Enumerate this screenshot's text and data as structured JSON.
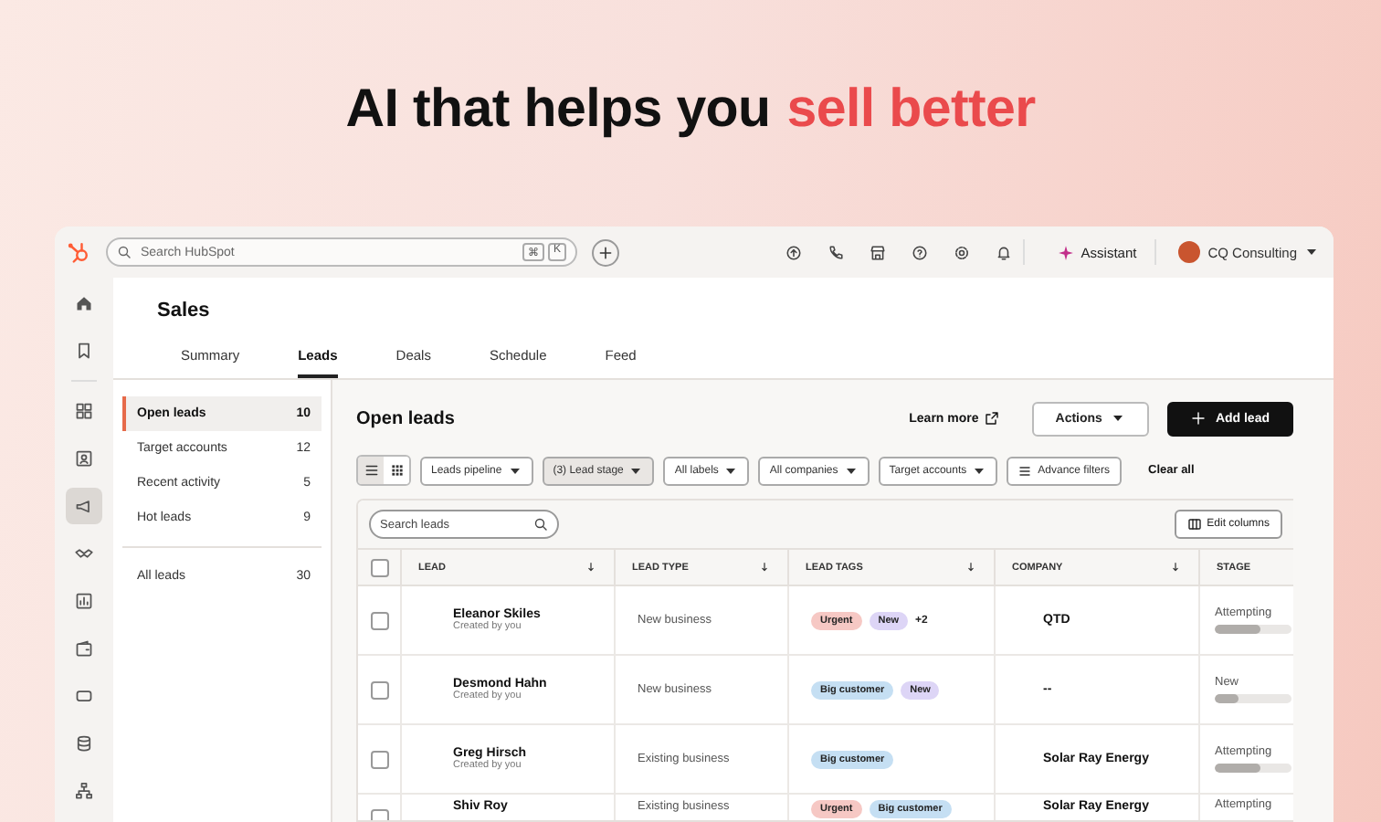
{
  "headline": {
    "text": "AI that helps you",
    "highlight": "sell better"
  },
  "topbar": {
    "search_placeholder": "Search HubSpot",
    "shortcut": [
      "⌘",
      "K"
    ],
    "icons": [
      {
        "kind": "upgrade"
      },
      {
        "kind": "phone"
      },
      {
        "kind": "store"
      },
      {
        "kind": "help"
      },
      {
        "kind": "settings"
      },
      {
        "kind": "bell"
      }
    ],
    "assistant": "Assistant",
    "account": "CQ Consulting"
  },
  "rail": [
    {
      "kind": "home",
      "selected": false
    },
    {
      "kind": "bookmark",
      "selected": false
    },
    {
      "kind": "grid",
      "selected": false
    },
    {
      "kind": "contact",
      "selected": false
    },
    {
      "kind": "megaphone",
      "selected": true
    },
    {
      "kind": "handshake",
      "selected": false
    },
    {
      "kind": "report",
      "selected": false
    },
    {
      "kind": "wallet",
      "selected": false
    },
    {
      "kind": "chat",
      "selected": false
    },
    {
      "kind": "database",
      "selected": false
    },
    {
      "kind": "tree",
      "selected": false
    }
  ],
  "page": {
    "title": "Sales",
    "tabs": [
      {
        "label": "Summary",
        "selected": false
      },
      {
        "label": "Leads",
        "selected": true
      },
      {
        "label": "Deals",
        "selected": false
      },
      {
        "label": "Schedule",
        "selected": false
      },
      {
        "label": "Feed",
        "selected": false
      }
    ]
  },
  "views": [
    {
      "label": "Open leads",
      "count": "10",
      "selected": true
    },
    {
      "label": "Target accounts",
      "count": "12",
      "selected": false
    },
    {
      "label": "Recent activity",
      "count": "5",
      "selected": false
    },
    {
      "label": "Hot leads",
      "count": "9",
      "selected": false
    }
  ],
  "all_views": [
    {
      "label": "All leads",
      "count": "30",
      "selected": false
    }
  ],
  "content": {
    "title": "Open leads",
    "learn_more": "Learn more",
    "actions": "Actions",
    "add_lead": "Add lead"
  },
  "view_toggle": [
    {
      "kind": "list",
      "selected": true
    },
    {
      "kind": "grid",
      "selected": false
    }
  ],
  "filters": [
    {
      "label": "Leads pipeline",
      "active": false
    },
    {
      "label": "(3) Lead stage",
      "active": true
    },
    {
      "label": "All labels",
      "active": false
    },
    {
      "label": "All companies",
      "active": false
    },
    {
      "label": "Target accounts",
      "active": false
    }
  ],
  "advance_filters": "Advance filters",
  "clear_all": "Clear all",
  "table": {
    "search_placeholder": "Search leads",
    "edit_columns": "Edit columns",
    "header_checked": false,
    "columns": [
      {
        "label": "LEAD",
        "sortable": true
      },
      {
        "label": "LEAD TYPE",
        "sortable": true
      },
      {
        "label": "LEAD TAGS",
        "sortable": true
      },
      {
        "label": "COMPANY",
        "sortable": true
      },
      {
        "label": "STAGE",
        "sortable": false
      }
    ],
    "rows": [
      {
        "checked": false,
        "name": "Eleanor Skiles",
        "created": "Created by you",
        "lead_type": "New business",
        "tags": [
          {
            "label": "Urgent",
            "color": "#f6c8c4"
          },
          {
            "label": "New",
            "color": "#ddd5f6"
          }
        ],
        "more_tags": "+2",
        "company": "QTD",
        "stage": "Attempting",
        "level": 0.6
      },
      {
        "checked": false,
        "name": "Desmond Hahn",
        "created": "Created by you",
        "lead_type": "New business",
        "tags": [
          {
            "label": "Big customer",
            "color": "#c5dff3"
          },
          {
            "label": "New",
            "color": "#ddd5f6"
          }
        ],
        "company": "--",
        "stage": "New",
        "level": 0.3
      },
      {
        "checked": false,
        "name": "Greg Hirsch",
        "created": "Created by you",
        "lead_type": "Existing business",
        "tags": [
          {
            "label": "Big customer",
            "color": "#c5dff3"
          }
        ],
        "company": "Solar Ray Energy",
        "stage": "Attempting",
        "level": 0.6
      },
      {
        "checked": false,
        "name": "Shiv Roy",
        "lead_type": "Existing business",
        "tags": [
          {
            "label": "Urgent",
            "color": "#f6c8c4"
          },
          {
            "label": "Big customer",
            "color": "#c5dff3"
          }
        ],
        "company": "Solar Ray Energy",
        "stage": "Attempting"
      }
    ]
  }
}
